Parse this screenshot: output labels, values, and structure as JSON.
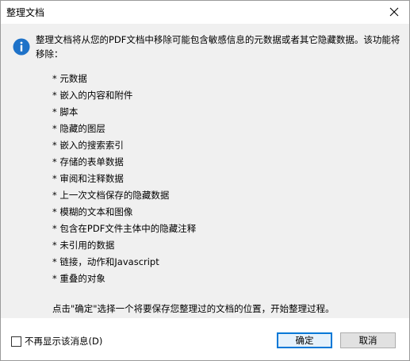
{
  "dialog": {
    "title": "整理文档",
    "close_label": "✕"
  },
  "icon": {
    "name": "info-icon",
    "color": "#1e72c8"
  },
  "message": "整理文档将从您的PDF文档中移除可能包含敏感信息的元数据或者其它隐藏数据。该功能将移除：",
  "items": [
    "* 元数据",
    "* 嵌入的内容和附件",
    "* 脚本",
    "* 隐藏的图层",
    "* 嵌入的搜索索引",
    "* 存储的表单数据",
    "* 审阅和注释数据",
    "* 上一次文档保存的隐藏数据",
    "* 模糊的文本和图像",
    "* 包含在PDF文件主体中的隐藏注释",
    "* 未引用的数据",
    "* 链接，动作和Javascript",
    "* 重叠的对象"
  ],
  "footer_message": "点击\"确定\"选择一个将要保存您整理过的文档的位置，开始整理过程。",
  "checkbox": {
    "label": "不再显示该消息(D)",
    "checked": false
  },
  "buttons": {
    "ok": "确定",
    "cancel": "取消"
  },
  "colors": {
    "accent": "#0078d7",
    "content_bg": "#f0f0f0"
  }
}
